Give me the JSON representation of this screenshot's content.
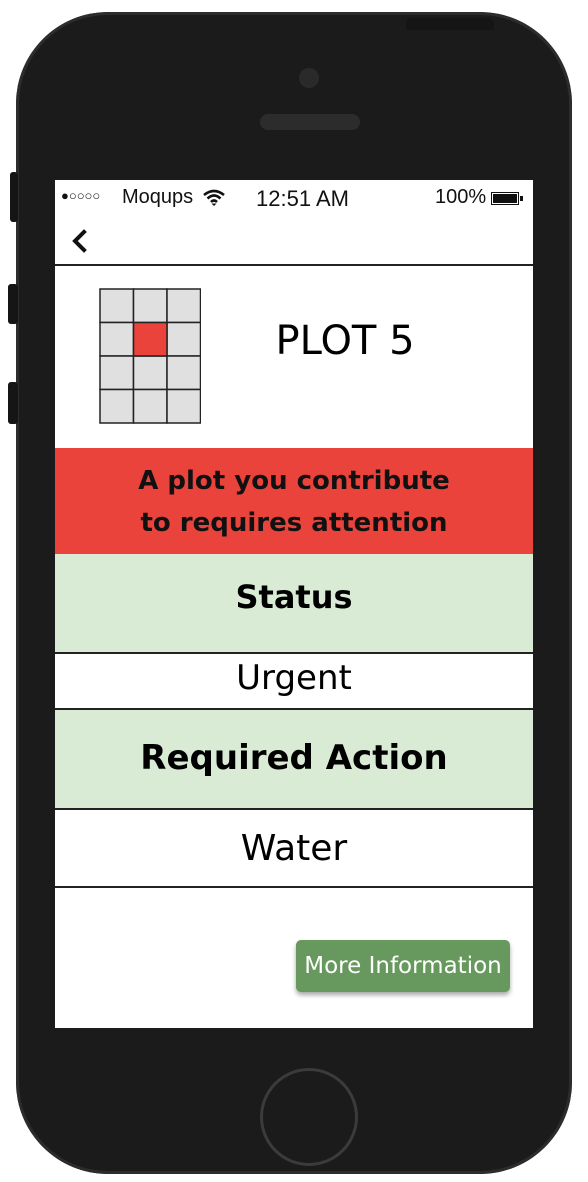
{
  "statusbar": {
    "signal": "●○○○○",
    "carrier": "Moqups",
    "wifi_icon": "wifi-icon",
    "time": "12:51 AM",
    "battery": "100%"
  },
  "nav": {
    "back_icon": "chevron-left-icon"
  },
  "plot": {
    "title": "PLOT 5",
    "grid": {
      "rows": 4,
      "cols": 3,
      "highlighted": [
        1,
        1
      ],
      "cell_color": "#e0e0e0",
      "highlight_color": "#e9433b"
    }
  },
  "alert": {
    "line1": "A plot you contribute",
    "line2": "to requires attention",
    "color": "#e9433b"
  },
  "status": {
    "heading": "Status",
    "value": "Urgent"
  },
  "required_action": {
    "heading": "Required Action",
    "value": "Water"
  },
  "more_button": {
    "label": "More Information",
    "color": "#67985d"
  },
  "colors": {
    "section_bg": "#d9ead5",
    "device": "#1b1b1b"
  }
}
